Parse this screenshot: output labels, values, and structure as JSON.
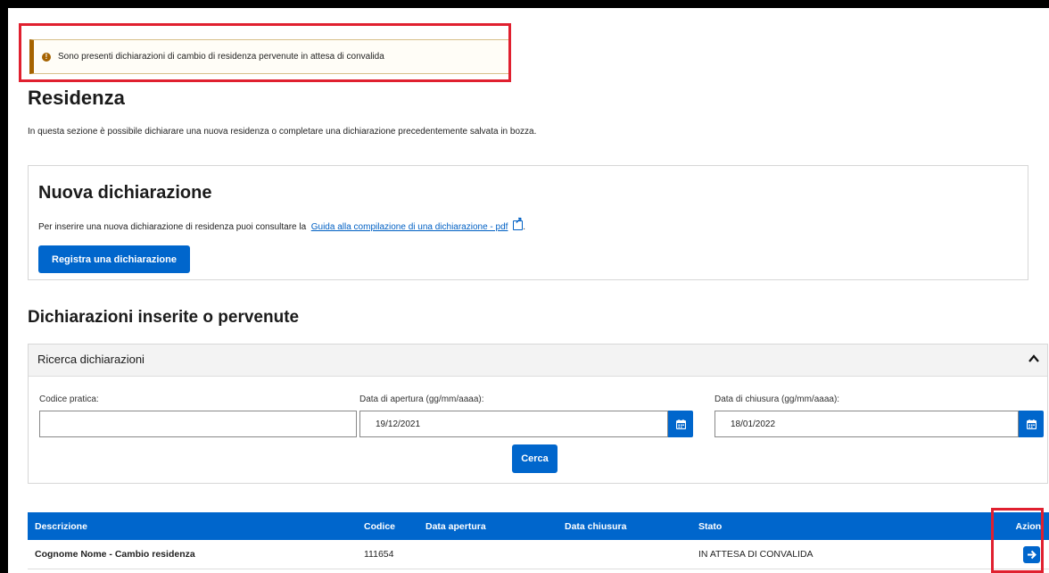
{
  "alert": {
    "icon": "exclamation-circle-icon",
    "message": "Sono presenti dichiarazioni di cambio di residenza pervenute in attesa di convalida"
  },
  "page": {
    "title": "Residenza",
    "intro": "In questa sezione è possibile dichiarare una nuova residenza o completare una dichiarazione precedentemente salvata in bozza."
  },
  "new_declaration": {
    "title": "Nuova dichiarazione",
    "guide_text": "Per inserire una nuova dichiarazione di residenza puoi consultare la",
    "guide_link": "Guida alla compilazione di una dichiarazione - pdf",
    "guide_icon": "external-link-icon",
    "register_button": "Registra una dichiarazione"
  },
  "list": {
    "title": "Dichiarazioni inserite o pervenute",
    "search": {
      "title": "Ricerca dichiarazioni",
      "toggle_icon": "chevron-up-icon",
      "codice_label": "Codice pratica:",
      "codice_value": "",
      "apertura_label": "Data di apertura (gg/mm/aaaa):",
      "apertura_value": "19/12/2021",
      "chiusura_label": "Data di chiusura (gg/mm/aaaa):",
      "chiusura_value": "18/01/2022",
      "calendar_icon": "calendar-icon",
      "search_button": "Cerca"
    },
    "table": {
      "headers": [
        "Descrizione",
        "Codice",
        "Data apertura",
        "Data chiusura",
        "Stato",
        "Azioni"
      ],
      "rows": [
        {
          "descrizione": "Cognome Nome - Cambio residenza",
          "codice": "111654",
          "data_apertura": "",
          "data_chiusura": "",
          "stato": "IN ATTESA DI CONVALIDA",
          "action_icon": "arrow-right-icon"
        }
      ]
    }
  },
  "colors": {
    "primary": "#0066cc",
    "highlight": "#e0202f",
    "warning": "#a66300"
  }
}
